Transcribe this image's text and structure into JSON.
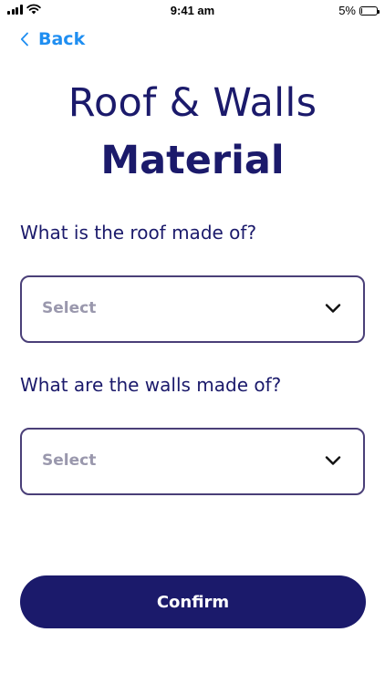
{
  "status_bar": {
    "time": "9:41 am",
    "battery_text": "5%",
    "battery_level": 0.05,
    "icons": [
      "signal-icon",
      "wifi-icon",
      "battery-icon"
    ]
  },
  "nav": {
    "back_label": "Back",
    "back_icon": "chevron-left-icon"
  },
  "header": {
    "title_line1": "Roof & Walls",
    "title_line2": "Material"
  },
  "form": {
    "roof": {
      "question": "What is the roof made of?",
      "selected_value": "Select",
      "icon": "chevron-down-icon"
    },
    "walls": {
      "question": "What are the walls made of?",
      "selected_value": "Select",
      "icon": "chevron-down-icon"
    }
  },
  "actions": {
    "confirm_label": "Confirm"
  },
  "colors": {
    "primary": "#1b1a6b",
    "link": "#1f8ef1",
    "border": "#4a3f78",
    "placeholder": "#9a98ad",
    "background": "#ffffff"
  }
}
